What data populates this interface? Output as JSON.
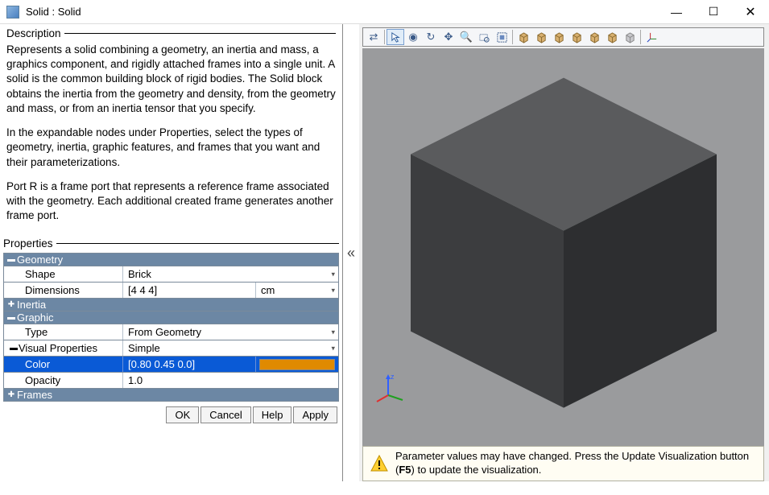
{
  "window": {
    "title": "Solid : Solid"
  },
  "description": {
    "heading": "Description",
    "p1": "Represents a solid combining a geometry, an inertia and mass, a graphics component, and rigidly attached frames into a single unit. A solid is the common building block of rigid bodies. The Solid block obtains the inertia from the geometry and density, from the geometry and mass, or from an inertia tensor that you specify.",
    "p2": "In the expandable nodes under Properties, select the types of geometry, inertia, graphic features, and frames that you want and their parameterizations.",
    "p3": "Port R is a frame port that represents a reference frame associated with the geometry. Each additional created frame generates another frame port."
  },
  "properties": {
    "heading": "Properties",
    "geometry": {
      "label": "Geometry",
      "shape_label": "Shape",
      "shape_value": "Brick",
      "dimensions_label": "Dimensions",
      "dimensions_value": "[4 4 4]",
      "dimensions_unit": "cm"
    },
    "inertia": {
      "label": "Inertia"
    },
    "graphic": {
      "label": "Graphic",
      "type_label": "Type",
      "type_value": "From Geometry",
      "visual_label": "Visual Properties",
      "visual_value": "Simple",
      "color_label": "Color",
      "color_value": "[0.80 0.45 0.0]",
      "color_swatch": "#e08a00",
      "opacity_label": "Opacity",
      "opacity_value": "1.0"
    },
    "frames": {
      "label": "Frames"
    }
  },
  "buttons": {
    "ok": "OK",
    "cancel": "Cancel",
    "help": "Help",
    "apply": "Apply"
  },
  "notice": {
    "text_a": "Parameter values may have changed. Press the Update Visualization button (",
    "text_b": "F5",
    "text_c": ") to update the visualization."
  },
  "toolbar_icons": [
    "swap-icon",
    "arrow-icon",
    "orbit-icon",
    "rotate-icon",
    "pan-icon",
    "zoom-icon",
    "zoom-region-icon",
    "fit-icon",
    "view-front-icon",
    "view-back-icon",
    "view-top-icon",
    "view-bottom-icon",
    "view-left-icon",
    "view-right-icon",
    "view-iso-icon",
    "axes-icon"
  ]
}
